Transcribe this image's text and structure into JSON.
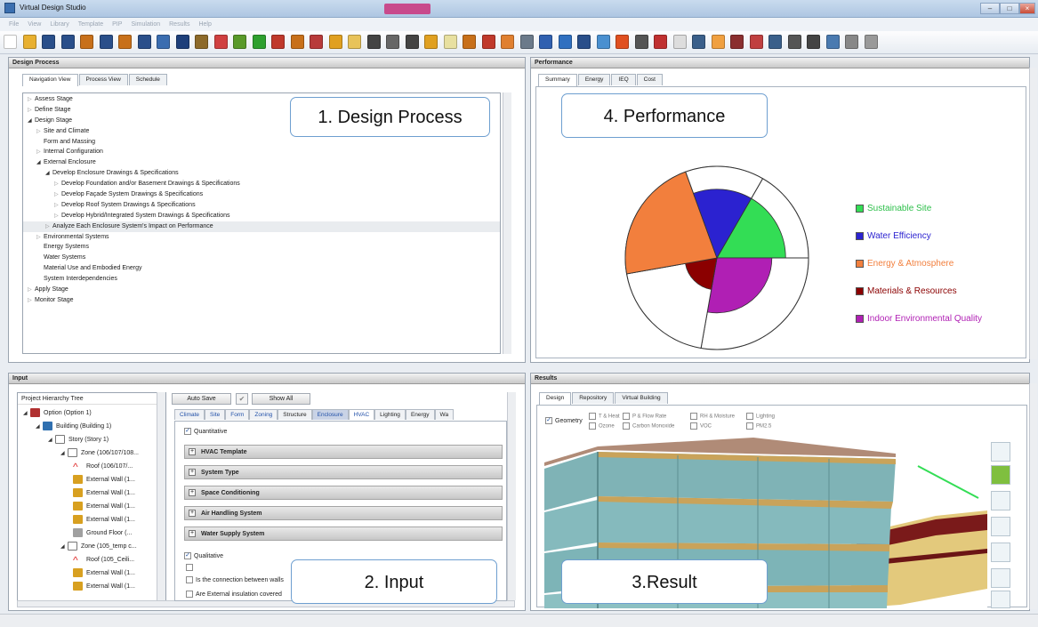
{
  "window": {
    "title": "Virtual Design Studio",
    "accent_color": "#c84a8c"
  },
  "menu": [
    "File",
    "View",
    "Library",
    "Template",
    "PIP",
    "Simulation",
    "Results",
    "Help"
  ],
  "toolbar_icons": [
    "new-icon",
    "open-icon",
    "save-icon",
    "save-as-icon",
    "folder-icon",
    "save-all-icon",
    "folder-icon",
    "save-icon",
    "chart-icon",
    "vds-icon",
    "wrench-icon",
    "pencil-icon",
    "check-icon",
    "play-icon",
    "brick-icon",
    "folder-icon",
    "bar-chart-icon",
    "image-icon",
    "window-icon",
    "globe-icon",
    "building-icon",
    "globe-icon",
    "person-icon",
    "bulb-icon",
    "mug-icon",
    "grid-icon",
    "diamond-icon",
    "tools-icon",
    "person-icon",
    "fan-icon",
    "box-icon",
    "snow-icon",
    "fire-icon",
    "sigma-icon",
    "calendar-icon",
    "calendar-icon",
    "cube-icon",
    "pie-icon",
    "arrow-icon",
    "hammer-icon",
    "home-icon",
    "number-icon",
    "house-icon",
    "monitor-icon",
    "user-icon",
    "power-icon"
  ],
  "design_process": {
    "header": "Design Process",
    "tabs": [
      "Navigation View",
      "Process View",
      "Schedule"
    ],
    "callout": "1. Design Process",
    "tree": [
      {
        "label": "Assess Stage",
        "indent": 0,
        "toggle": "closed"
      },
      {
        "label": "Define Stage",
        "indent": 0,
        "toggle": "closed"
      },
      {
        "label": "Design Stage",
        "indent": 0,
        "toggle": "open"
      },
      {
        "label": "Site and Climate",
        "indent": 1,
        "toggle": "closed"
      },
      {
        "label": "Form and Massing",
        "indent": 1,
        "toggle": "none"
      },
      {
        "label": "Internal Configuration",
        "indent": 1,
        "toggle": "closed"
      },
      {
        "label": "External Enclosure",
        "indent": 1,
        "toggle": "open"
      },
      {
        "label": "Develop Enclosure Drawings & Specifications",
        "indent": 2,
        "toggle": "open"
      },
      {
        "label": "Develop Foundation and/or Basement Drawings & Specifications",
        "indent": 3,
        "toggle": "closed"
      },
      {
        "label": "Develop Façade System Drawings & Specifications",
        "indent": 3,
        "toggle": "closed"
      },
      {
        "label": "Develop Roof System Drawings & Specifications",
        "indent": 3,
        "toggle": "closed"
      },
      {
        "label": "Develop Hybrid/Integrated System Drawings & Specifications",
        "indent": 3,
        "toggle": "closed"
      },
      {
        "label": "Analyze Each Enclosure System's Impact on Performance",
        "indent": 2,
        "toggle": "closed",
        "selected": true
      },
      {
        "label": "Environmental Systems",
        "indent": 1,
        "toggle": "closed"
      },
      {
        "label": "Energy Systems",
        "indent": 1,
        "toggle": "none"
      },
      {
        "label": "Water Systems",
        "indent": 1,
        "toggle": "none"
      },
      {
        "label": "Material Use and Embodied Energy",
        "indent": 1,
        "toggle": "none"
      },
      {
        "label": "System Interdependencies",
        "indent": 1,
        "toggle": "none"
      },
      {
        "label": "Apply Stage",
        "indent": 0,
        "toggle": "closed"
      },
      {
        "label": "Monitor Stage",
        "indent": 0,
        "toggle": "closed"
      }
    ]
  },
  "performance": {
    "header": "Performance",
    "tabs": [
      "Summary",
      "Energy",
      "IEQ",
      "Cost"
    ],
    "callout": "4. Performance"
  },
  "chart_data": {
    "type": "pie",
    "title": "",
    "slices": [
      {
        "name": "Sustainable Site",
        "color": "#33dd55",
        "start_deg": 30,
        "end_deg": 90,
        "value": 0.75
      },
      {
        "name": "Indoor Environmental Quality",
        "color": "#b01fb4",
        "start_deg": 90,
        "end_deg": 190,
        "value": 0.6
      },
      {
        "name": "Materials & Resources",
        "color": "#8b0000",
        "start_deg": 190,
        "end_deg": 260,
        "value": 0.35
      },
      {
        "name": "Energy & Atmosphere",
        "color": "#f27f3d",
        "start_deg": 260,
        "end_deg": 340,
        "value": 1.0
      },
      {
        "name": "Water Efficiency",
        "color": "#2b22d0",
        "start_deg": 340,
        "end_deg": 390,
        "value": 0.75
      }
    ],
    "legend_placement": "right",
    "legend": [
      {
        "label": "Sustainable Site",
        "color": "#33dd55"
      },
      {
        "label": "Water Efficiency",
        "color": "#2b22d0"
      },
      {
        "label": "Energy & Atmosphere",
        "color": "#f27f3d"
      },
      {
        "label": "Materials & Resources",
        "color": "#8b0000"
      },
      {
        "label": "Indoor Environmental Quality",
        "color": "#b01fb4"
      }
    ]
  },
  "input": {
    "header": "Input",
    "callout": "2. Input",
    "hierarchy_title": "Project Hierarchy Tree",
    "auto_save": "Auto Save",
    "show_all": "Show All",
    "category_tabs": [
      "Climate",
      "Site",
      "Form",
      "Zoning",
      "Structure",
      "Enclosure",
      "HVAC",
      "Lighting",
      "Energy",
      "Wa"
    ],
    "active_tab": "HVAC",
    "quantitative": "Quantitative",
    "qualitative": "Qualitative",
    "sections": [
      "HVAC Template",
      "System Type",
      "Space Conditioning",
      "Air Handling System",
      "Water Supply System"
    ],
    "questions": [
      "Is the connection between walls",
      "Are External insulation covered"
    ],
    "hierarchy": [
      {
        "label": "Option (Option 1)",
        "indent": 0,
        "icon": "option-icon"
      },
      {
        "label": "Building (Building 1)",
        "indent": 1,
        "icon": "building-icon"
      },
      {
        "label": "Story (Story 1)",
        "indent": 2,
        "icon": "story-icon"
      },
      {
        "label": "Zone (106/107/108...",
        "indent": 3,
        "icon": "zone-icon"
      },
      {
        "label": "Roof (106/107/...",
        "indent": 4,
        "icon": "roof-icon"
      },
      {
        "label": "External Wall (1...",
        "indent": 4,
        "icon": "wall-icon"
      },
      {
        "label": "External Wall (1...",
        "indent": 4,
        "icon": "wall-icon"
      },
      {
        "label": "External Wall (1...",
        "indent": 4,
        "icon": "wall-icon"
      },
      {
        "label": "External Wall (1...",
        "indent": 4,
        "icon": "wall-icon"
      },
      {
        "label": "Ground Floor (...",
        "indent": 4,
        "icon": "floor-icon"
      },
      {
        "label": "Zone (105_temp c...",
        "indent": 3,
        "icon": "zone-icon"
      },
      {
        "label": "Roof (105_Ceili...",
        "indent": 4,
        "icon": "roof-icon"
      },
      {
        "label": "External Wall (1...",
        "indent": 4,
        "icon": "wall-icon"
      },
      {
        "label": "External Wall (1...",
        "indent": 4,
        "icon": "wall-icon"
      }
    ]
  },
  "results": {
    "header": "Results",
    "callout": "3.Result",
    "tabs": [
      "Design",
      "Repository",
      "Virtual Building"
    ],
    "geometry": "Geometry",
    "checks_row1": [
      "T & Heat",
      "P & Flow Rate",
      "RH & Moisture",
      "Lighting"
    ],
    "checks_row2": [
      "Ozone",
      "Carbon Monoxide",
      "VOC",
      "PM2.5"
    ]
  }
}
